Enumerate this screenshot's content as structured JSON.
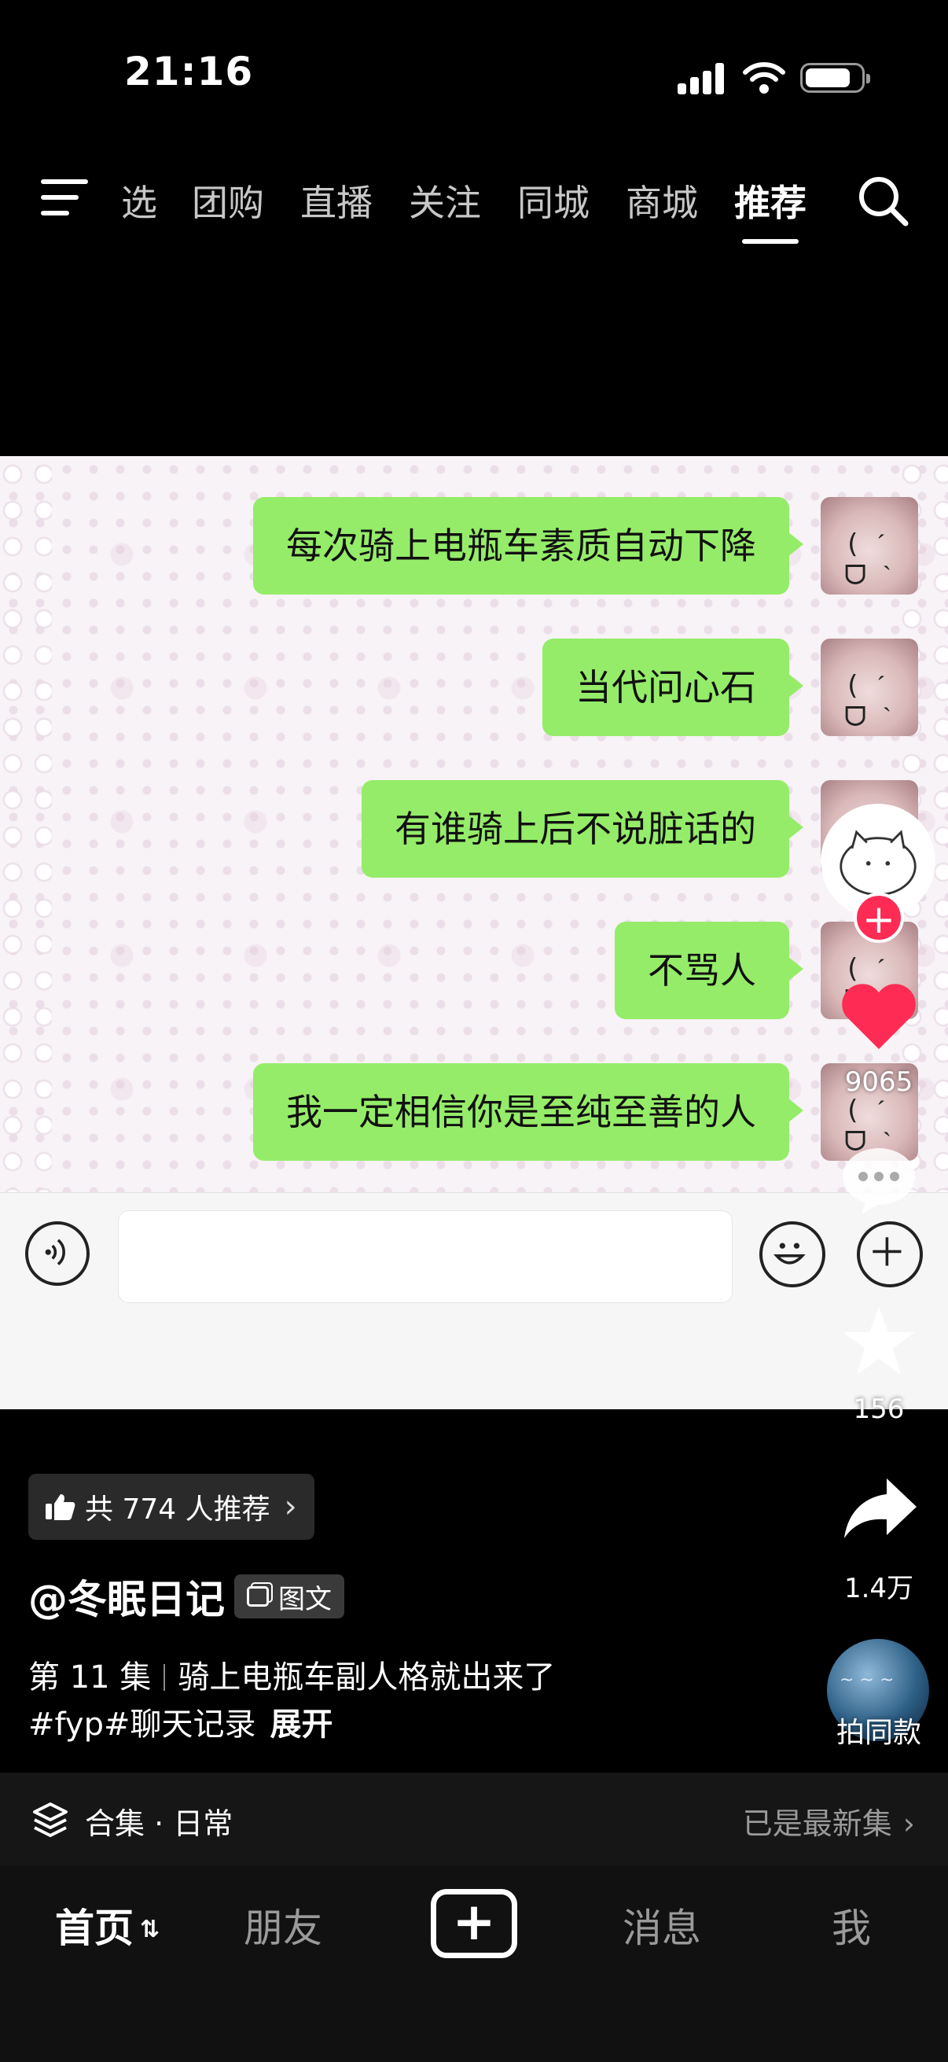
{
  "status_bar": {
    "time": "21:16",
    "battery_level": 0.8
  },
  "top_nav": {
    "tabs": [
      {
        "label": "选"
      },
      {
        "label": "团购"
      },
      {
        "label": "直播"
      },
      {
        "label": "关注"
      },
      {
        "label": "同城"
      },
      {
        "label": "商城"
      },
      {
        "label": "推荐",
        "active": true
      }
    ]
  },
  "chat": {
    "messages": [
      {
        "text": "每次骑上电瓶车素质自动下降"
      },
      {
        "text": "当代问心石"
      },
      {
        "text": "有谁骑上后不说脏话的"
      },
      {
        "text": "不骂人"
      },
      {
        "text": "我一定相信你是至纯至善的人"
      }
    ],
    "bubble_color": "#95ec69",
    "avatar_face": "( ˊ ᗜ ˋ )"
  },
  "actions": {
    "likes": "9065",
    "comments": "",
    "favorites": "156",
    "shares": "1.4万",
    "follow_label": "+",
    "music_label": "拍同款",
    "accent_color": "#fe2c55"
  },
  "post": {
    "recommend_text": "共 774 人推荐",
    "author": "@冬眠日记",
    "type_tag": "图文",
    "episode": "第 11 集",
    "title": "骑上电瓶车副人格就出来了",
    "hashtags": "#fyp#聊天记录",
    "expand_label": "展开"
  },
  "collection": {
    "label": "合集 · 日常",
    "status": "已是最新集"
  },
  "bottom_nav": {
    "home": "首页",
    "friends": "朋友",
    "create": "+",
    "messages": "消息",
    "me": "我"
  }
}
